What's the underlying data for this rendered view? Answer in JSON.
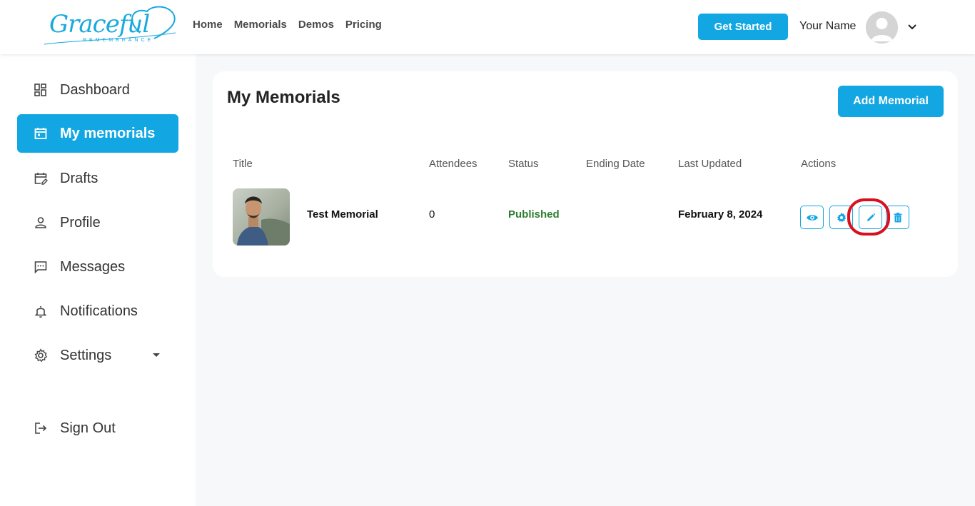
{
  "header": {
    "logo_text": "Graceful",
    "logo_subtext": "REMEMBRANCE",
    "nav": [
      {
        "label": "Home"
      },
      {
        "label": "Memorials"
      },
      {
        "label": "Demos"
      },
      {
        "label": "Pricing"
      }
    ],
    "get_started_label": "Get Started",
    "user_name": "Your Name"
  },
  "sidebar": {
    "items": [
      {
        "label": "Dashboard",
        "icon": "dashboard-icon"
      },
      {
        "label": "My memorials",
        "icon": "calendar-icon",
        "active": true
      },
      {
        "label": "Drafts",
        "icon": "calendar-edit-icon"
      },
      {
        "label": "Profile",
        "icon": "person-icon"
      },
      {
        "label": "Messages",
        "icon": "message-icon"
      },
      {
        "label": "Notifications",
        "icon": "bell-icon"
      },
      {
        "label": "Settings",
        "icon": "gear-icon"
      }
    ],
    "sign_out_label": "Sign Out"
  },
  "main": {
    "title": "My Memorials",
    "add_button_label": "Add Memorial",
    "table": {
      "headers": [
        "Title",
        "Attendees",
        "Status",
        "Ending Date",
        "Last Updated",
        "Actions"
      ],
      "rows": [
        {
          "title": "Test Memorial",
          "attendees": "0",
          "status": "Published",
          "ending_date": "",
          "last_updated": "February 8, 2024"
        }
      ]
    }
  },
  "colors": {
    "accent": "#12a7e3",
    "published": "#2e7d32",
    "highlight": "#d8101f"
  }
}
